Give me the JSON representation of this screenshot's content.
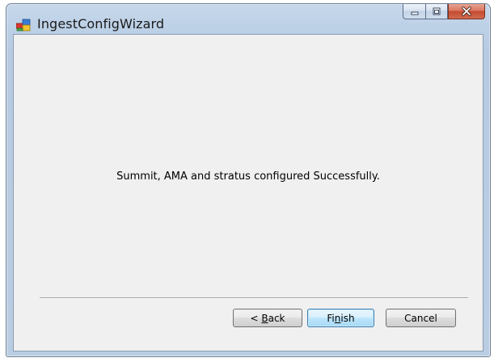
{
  "window": {
    "title": "IngestConfigWizard"
  },
  "caption_buttons": {
    "minimize_icon": "minimize-icon",
    "maximize_icon": "maximize-icon",
    "close_icon": "close-icon"
  },
  "content": {
    "message": "Summit, AMA and stratus configured Successfully."
  },
  "buttons": {
    "back_prefix": "< ",
    "back_mnemonic": "B",
    "back_rest": "ack",
    "finish_prefix": "Fi",
    "finish_mnemonic": "n",
    "finish_rest": "ish",
    "cancel": "Cancel"
  },
  "colors": {
    "client_background": "#f0f0f0",
    "finish_accent": "#3c7fb1",
    "close_button": "#c44a30"
  }
}
